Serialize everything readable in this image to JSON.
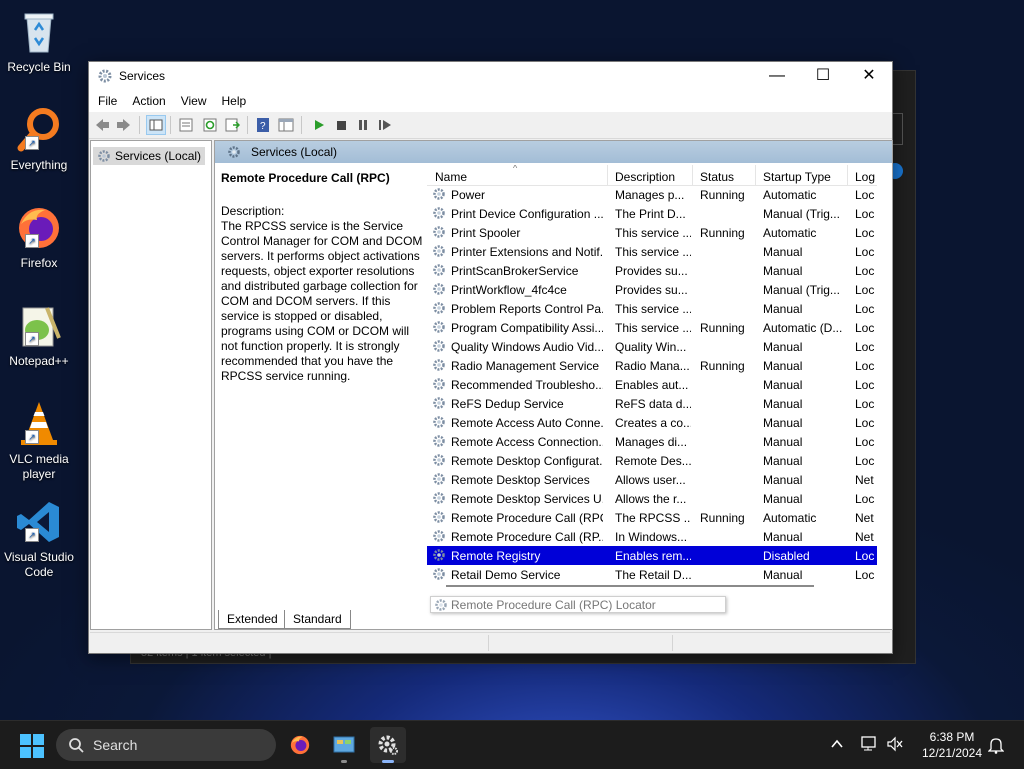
{
  "desktop": {
    "icons": [
      {
        "label": "Recycle Bin"
      },
      {
        "label": "Everything"
      },
      {
        "label": "Firefox"
      },
      {
        "label": "Notepad++"
      },
      {
        "label": "VLC media player"
      },
      {
        "label": "Visual Studio Code"
      }
    ]
  },
  "background_window": {
    "status_text": "52 items  |  1 item selected  |"
  },
  "window": {
    "title": "Services",
    "menu": [
      "File",
      "Action",
      "Help",
      "View"
    ],
    "tree_node": "Services (Local)",
    "header_title": "Services (Local)",
    "selected_service": {
      "title": "Remote Procedure Call (RPC)",
      "description_label": "Description:",
      "description": "The RPCSS service is the Service Control Manager for COM and DCOM servers. It performs object activations requests, object exporter resolutions and distributed garbage collection for COM and DCOM servers. If this service is stopped or disabled, programs using COM or DCOM will not function properly. It is strongly recommended that you have the RPCSS service running."
    },
    "columns": [
      "Name",
      "Description",
      "Status",
      "Startup Type",
      "Log"
    ],
    "rows": [
      {
        "name": "Power",
        "desc": "Manages p...",
        "status": "Running",
        "startup": "Automatic",
        "log": "Loc"
      },
      {
        "name": "Print Device Configuration ...",
        "desc": "The Print D...",
        "status": "",
        "startup": "Manual (Trig...",
        "log": "Loc"
      },
      {
        "name": "Print Spooler",
        "desc": "This service ...",
        "status": "Running",
        "startup": "Automatic",
        "log": "Loc"
      },
      {
        "name": "Printer Extensions and Notif...",
        "desc": "This service ...",
        "status": "",
        "startup": "Manual",
        "log": "Loc"
      },
      {
        "name": "PrintScanBrokerService",
        "desc": "Provides su...",
        "status": "",
        "startup": "Manual",
        "log": "Loc"
      },
      {
        "name": "PrintWorkflow_4fc4ce",
        "desc": "Provides su...",
        "status": "",
        "startup": "Manual (Trig...",
        "log": "Loc"
      },
      {
        "name": "Problem Reports Control Pa...",
        "desc": "This service ...",
        "status": "",
        "startup": "Manual",
        "log": "Loc"
      },
      {
        "name": "Program Compatibility Assi...",
        "desc": "This service ...",
        "status": "Running",
        "startup": "Automatic (D...",
        "log": "Loc"
      },
      {
        "name": "Quality Windows Audio Vid...",
        "desc": "Quality Win...",
        "status": "",
        "startup": "Manual",
        "log": "Loc"
      },
      {
        "name": "Radio Management Service",
        "desc": "Radio Mana...",
        "status": "Running",
        "startup": "Manual",
        "log": "Loc"
      },
      {
        "name": "Recommended Troublesho...",
        "desc": "Enables aut...",
        "status": "",
        "startup": "Manual",
        "log": "Loc"
      },
      {
        "name": "ReFS Dedup Service",
        "desc": "ReFS data d...",
        "status": "",
        "startup": "Manual",
        "log": "Loc"
      },
      {
        "name": "Remote Access Auto Conne...",
        "desc": "Creates a co...",
        "status": "",
        "startup": "Manual",
        "log": "Loc"
      },
      {
        "name": "Remote Access Connection...",
        "desc": "Manages di...",
        "status": "",
        "startup": "Manual",
        "log": "Loc"
      },
      {
        "name": "Remote Desktop Configurat...",
        "desc": "Remote Des...",
        "status": "",
        "startup": "Manual",
        "log": "Loc"
      },
      {
        "name": "Remote Desktop Services",
        "desc": "Allows user...",
        "status": "",
        "startup": "Manual",
        "log": "Net"
      },
      {
        "name": "Remote Desktop Services U...",
        "desc": "Allows the r...",
        "status": "",
        "startup": "Manual",
        "log": "Loc"
      },
      {
        "name": "Remote Procedure Call (RPC)",
        "desc": "The RPCSS ...",
        "status": "Running",
        "startup": "Automatic",
        "log": "Net"
      },
      {
        "name": "Remote Procedure Call (RP...",
        "desc": "In Windows...",
        "status": "",
        "startup": "Manual",
        "log": "Net"
      },
      {
        "name": "Remote Registry",
        "desc": "Enables rem...",
        "status": "",
        "startup": "Disabled",
        "log": "Loc"
      },
      {
        "name": "Retail Demo Service",
        "desc": "The Retail D...",
        "status": "",
        "startup": "Manual",
        "log": "Loc"
      }
    ],
    "tooltip": "Remote Procedure Call (RPC) Locator",
    "tabs": [
      "Extended",
      "Standard"
    ]
  },
  "taskbar": {
    "search_placeholder": "Search",
    "time": "6:38 PM",
    "date": "12/21/2024"
  }
}
